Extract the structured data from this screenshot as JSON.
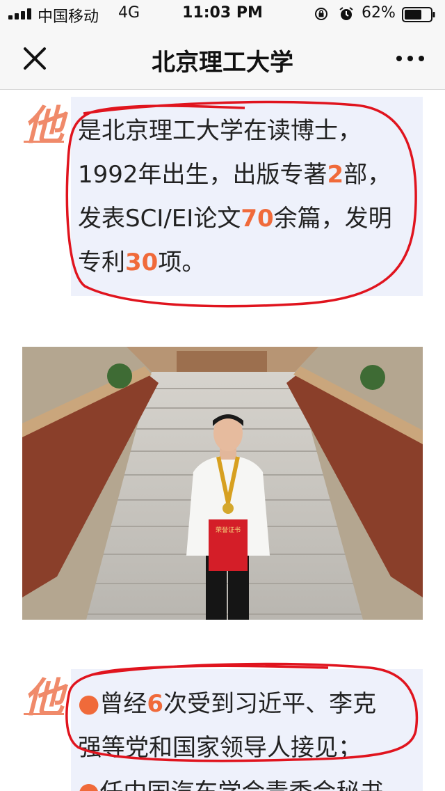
{
  "status": {
    "carrier": "中国移动",
    "network": "4G",
    "time": "11:03 PM",
    "battery": "62%"
  },
  "nav": {
    "title": "北京理工大学"
  },
  "article": {
    "mark": "他",
    "block1": {
      "line1": "是北京理工大学在读博士，",
      "line2_pre": "1992年出生，出版专著",
      "line2_num": "2",
      "line2_post": "部，",
      "line3_pre": "发表SCI/EI论文",
      "line3_num": "70",
      "line3_post": "余篇，发明",
      "line4_pre": "专利",
      "line4_num": "30",
      "line4_post": "项。"
    },
    "photo": {
      "certificate_text": "荣誉证书"
    },
    "block2": {
      "line1_pre": "曾经",
      "line1_num": "6",
      "line1_post": "次受到习近平、李克",
      "line2": "强等党和国家领导人接见；",
      "line3": "任中国汽车学会青委会秘书"
    }
  },
  "colors": {
    "highlight": "#f06a3a",
    "mark": "#f08a6a",
    "block_bg": "#eef1fb",
    "annotation": "#e0141e"
  }
}
